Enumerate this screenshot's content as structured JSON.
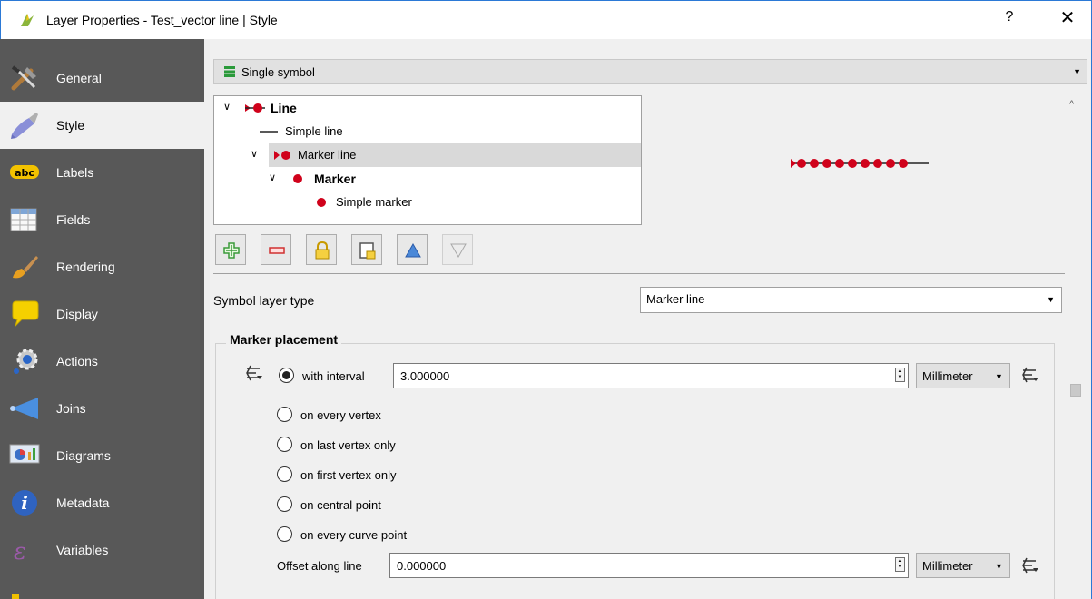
{
  "window": {
    "title": "Layer Properties - Test_vector line | Style",
    "help_label": "?",
    "close_label": "✕"
  },
  "sidebar": {
    "items": [
      {
        "label": "General",
        "icon": "tools-icon"
      },
      {
        "label": "Style",
        "icon": "paintbrush-icon"
      },
      {
        "label": "Labels",
        "icon": "abc-label-icon"
      },
      {
        "label": "Fields",
        "icon": "table-icon"
      },
      {
        "label": "Rendering",
        "icon": "brush-icon"
      },
      {
        "label": "Display",
        "icon": "speech-bubble-icon"
      },
      {
        "label": "Actions",
        "icon": "gear-icon"
      },
      {
        "label": "Joins",
        "icon": "join-icon"
      },
      {
        "label": "Diagrams",
        "icon": "diagram-icon"
      },
      {
        "label": "Metadata",
        "icon": "info-icon"
      },
      {
        "label": "Variables",
        "icon": "epsilon-icon"
      }
    ],
    "active": "Style"
  },
  "renderer": {
    "label": "Single symbol"
  },
  "symbol_tree": [
    {
      "label": "Line",
      "bold": true,
      "expanded": true
    },
    {
      "label": "Simple line"
    },
    {
      "label": "Marker line",
      "expanded": true,
      "selected": true
    },
    {
      "label": "Marker",
      "bold": true,
      "expanded": true
    },
    {
      "label": "Simple marker"
    }
  ],
  "symbol_layer_type": {
    "label": "Symbol layer type",
    "value": "Marker line"
  },
  "marker_placement": {
    "title": "Marker placement",
    "interval_label": "with interval",
    "interval_value": "3.000000",
    "interval_unit": "Millimeter",
    "options": [
      "on every vertex",
      "on last vertex only",
      "on first vertex only",
      "on central point",
      "on every curve point"
    ],
    "offset_label": "Offset along line",
    "offset_value": "0.000000",
    "offset_unit": "Millimeter"
  },
  "colors": {
    "sidebar_bg": "#585858",
    "marker_red": "#d0021b",
    "window_border": "#2b79d6"
  }
}
